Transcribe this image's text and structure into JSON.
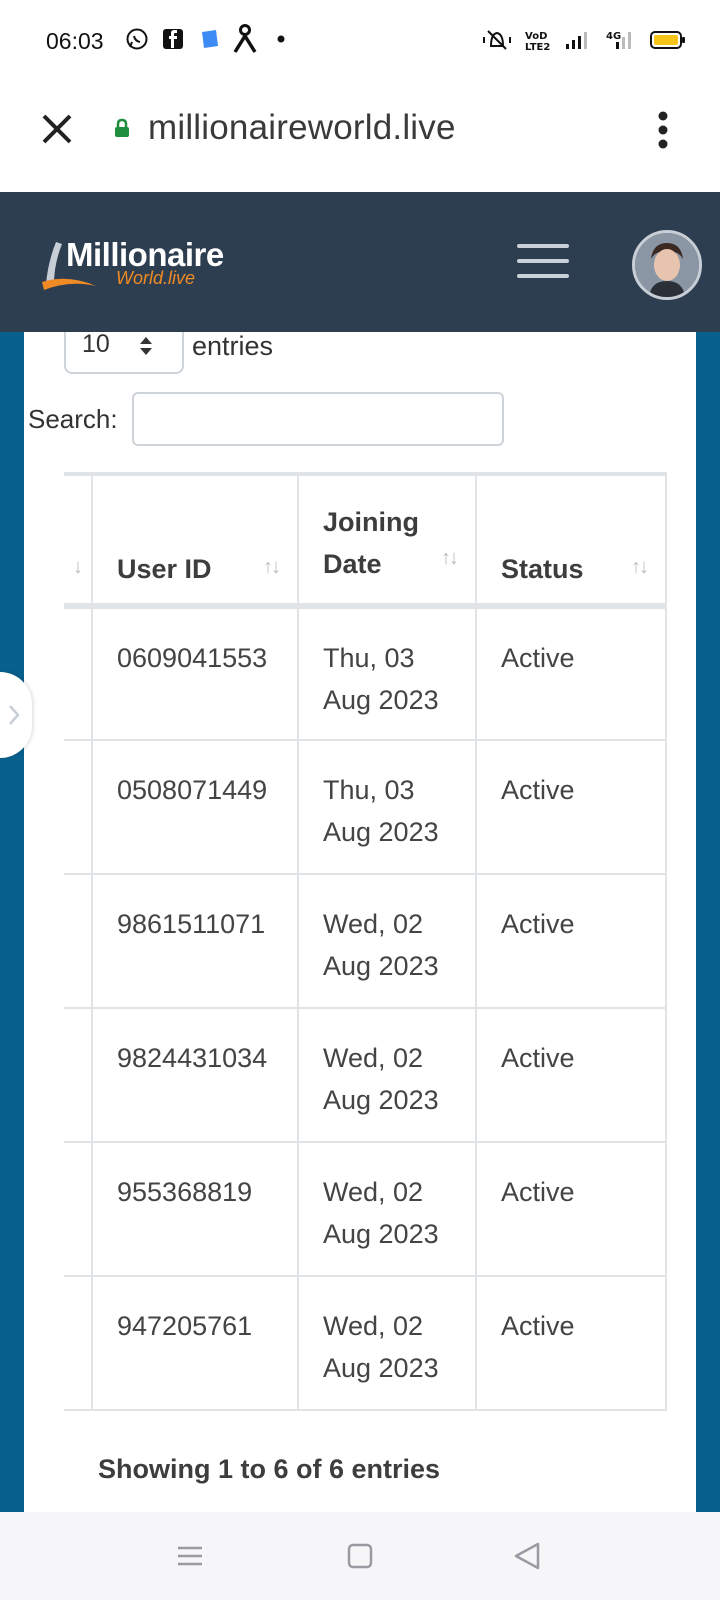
{
  "status_bar": {
    "time": "06:03",
    "left_icons": [
      "whatsapp-icon",
      "facebook-icon",
      "messenger-icon",
      "app-icon",
      "dot-icon"
    ],
    "right_icons": [
      "vibrate-icon",
      "volte-icon",
      "signal-icon",
      "4g-signal-icon",
      "battery-icon"
    ],
    "battery_color": "#f5c518"
  },
  "browser": {
    "url": "millionaireworld.live",
    "lock_color": "#1e8e3e"
  },
  "header": {
    "logo_top": "Millionaire",
    "logo_bottom": "World.live",
    "bg_color": "#2d3e50",
    "accent_color": "#f08a24"
  },
  "controls": {
    "page_length": "10",
    "entries_label": "entries",
    "search_label": "Search:",
    "search_value": ""
  },
  "table": {
    "columns": [
      "",
      "User ID",
      "Joining Date",
      "Status"
    ],
    "sort_icon": "↑↓",
    "rows": [
      {
        "user_id": "0609041553",
        "date_line1": "Thu, 03",
        "date_line2": "Aug 2023",
        "status": "Active"
      },
      {
        "user_id": "0508071449",
        "date_line1": "Thu, 03",
        "date_line2": "Aug 2023",
        "status": "Active"
      },
      {
        "user_id": "9861511071",
        "date_line1": "Wed, 02",
        "date_line2": "Aug 2023",
        "status": "Active"
      },
      {
        "user_id": "9824431034",
        "date_line1": "Wed, 02",
        "date_line2": "Aug 2023",
        "status": "Active"
      },
      {
        "user_id": "955368819",
        "date_line1": "Wed, 02",
        "date_line2": "Aug 2023",
        "status": "Active"
      },
      {
        "user_id": "947205761",
        "date_line1": "Wed, 02",
        "date_line2": "Aug 2023",
        "status": "Active"
      }
    ]
  },
  "info_text": "Showing 1 to 6 of 6 entries",
  "page_bg_color": "#08608d"
}
